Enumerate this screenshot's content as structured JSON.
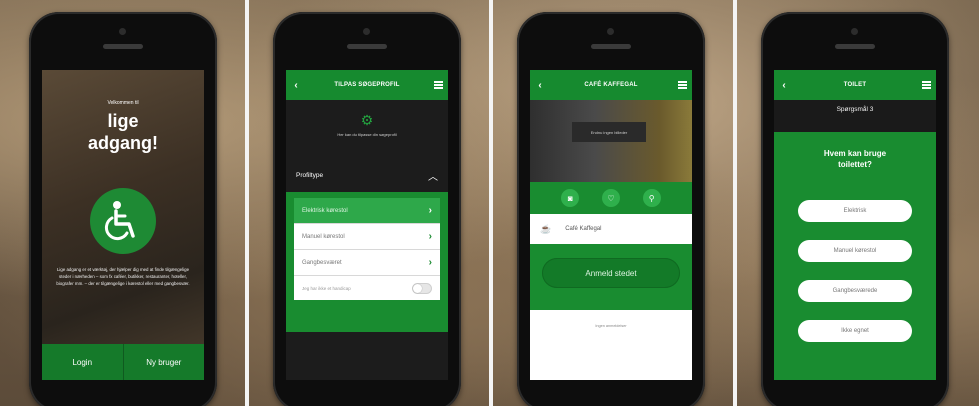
{
  "screen1": {
    "welcome": "Velkommen til",
    "title_line1": "lige",
    "title_line2": "adgang!",
    "description": "Lige adgang er et værktøj, der hjælper dig med at finde tilgængelige steder i nærheden – som fx caféer, butikker, restauranter, hoteller, biografer mm. – der er tilgængelige i kørestol eller med gangbesvær.",
    "login_label": "Login",
    "new_user_label": "Ny bruger",
    "accent": "#1e8a34"
  },
  "screen2": {
    "header_title": "TILPAS SØGEPROFIL",
    "subtitle": "Her kan du tilpasse din søgeprofil",
    "section_label": "Profiltype",
    "options": [
      {
        "label": "Elektrisk kørestol",
        "selected": true
      },
      {
        "label": "Manuel kørestol",
        "selected": false
      },
      {
        "label": "Gangbesværet",
        "selected": false
      }
    ],
    "toggle_label": "Jeg har ikke et handicap"
  },
  "screen3": {
    "header_title": "CAFÉ KAFFEGAL",
    "no_images": "Endnu ingen billeder",
    "place_name": "Café Kaffegal",
    "review_label": "Anmeld stedet",
    "no_reviews": "Ingen anmeldelser"
  },
  "screen4": {
    "header_title": "TOILET",
    "question_number": "Spørgsmål 3",
    "prompt_line1": "Hvem kan bruge",
    "prompt_line2": "toilettet?",
    "answers": [
      "Elektrisk",
      "Manuel kørestol",
      "Gangbesværede",
      "Ikke egnet"
    ]
  }
}
